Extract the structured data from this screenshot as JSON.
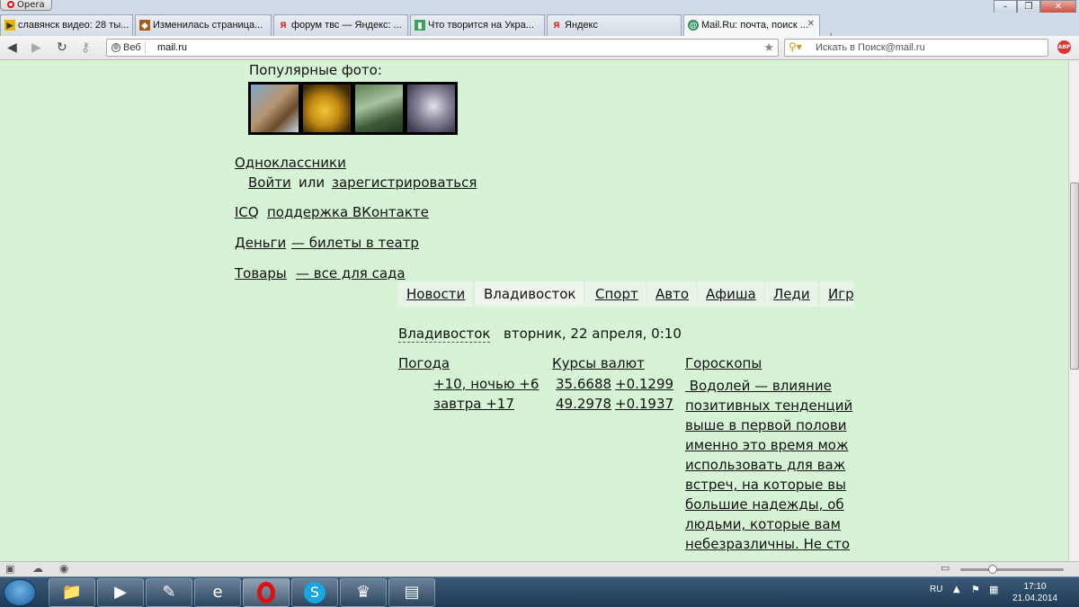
{
  "browser": {
    "app_name": "Opera",
    "tabs": [
      {
        "title": "славянск видео: 28 ты...",
        "icon": "video-icon"
      },
      {
        "title": "Изменилась страница...",
        "icon": "page-icon"
      },
      {
        "title": "форум твс — Яндекс: ...",
        "icon": "yandex-icon"
      },
      {
        "title": "Что творится на Укра...",
        "icon": "forum-icon"
      },
      {
        "title": "Яндекс",
        "icon": "yandex-icon"
      },
      {
        "title": "Mail.Ru: почта, поиск ...",
        "icon": "mailru-icon"
      }
    ],
    "address": {
      "badge": "Веб",
      "url": "mail.ru"
    },
    "search": {
      "placeholder": "Искать в Поиск@mail.ru"
    },
    "adblock_badge": "ABP"
  },
  "page": {
    "popular_photos_label": "Популярные фото:",
    "odnoklassniki": {
      "title": "Одноклассники",
      "login": "Войти",
      "or": "или",
      "register": "зарегистрироваться"
    },
    "links_row1": {
      "a": "ICQ",
      "b": "поддержка ВКонтакте"
    },
    "links_row2": {
      "a": "Деньги",
      "b": "— билеты в театр"
    },
    "links_row3": {
      "a": "Товары",
      "b": "— все для сада"
    },
    "tabs": [
      "Новости",
      "Владивосток",
      "Спорт",
      "Авто",
      "Афиша",
      "Леди",
      "Игр"
    ],
    "city": "Владивосток",
    "date": "вторник, 22 апреля, 0:10",
    "weather": {
      "title": "Погода",
      "line1": "+10, ночью +6",
      "line2": "завтра +17"
    },
    "currency": {
      "title": "Курсы валют",
      "usd": "35.6688",
      "usd_change": "+0.1299",
      "eur": "49.2978",
      "eur_change": "+0.1937"
    },
    "horoscope": {
      "title": "Гороскопы",
      "lines": [
        " Водолей — влияние",
        "позитивных тенденций",
        "выше в первой полови",
        "именно это время мож",
        "использовать для важ",
        "встреч, на которые вы",
        "большие надежды, об",
        "людьми, которые вам",
        "небезразличны. Не сто"
      ]
    }
  },
  "taskbar": {
    "lang": "RU",
    "time": "17:10",
    "date": "21.04.2014"
  }
}
